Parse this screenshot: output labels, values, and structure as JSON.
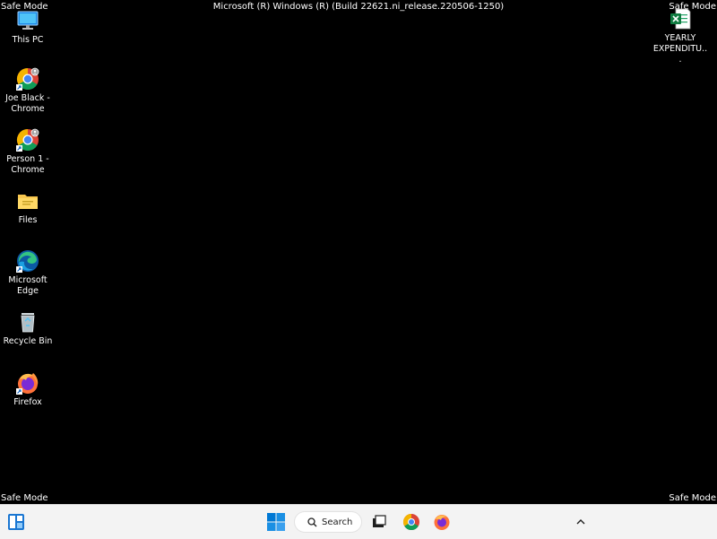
{
  "window": {
    "build_title": "Microsoft (R) Windows (R) (Build 22621.ni_release.220506-1250)",
    "safe_mode_top_left": "Safe Mode",
    "safe_mode_top_right": "Safe Mode",
    "safe_mode_bottom_left": "Safe Mode",
    "safe_mode_bottom_right": "Safe Mode"
  },
  "desktop": {
    "icons": [
      {
        "label": "This PC",
        "icon": "monitor-icon"
      },
      {
        "label": "Joe Black - Chrome",
        "icon": "chrome-profile-icon"
      },
      {
        "label": "Person 1 - Chrome",
        "icon": "chrome-profile-icon"
      },
      {
        "label": "Files",
        "icon": "folder-icon"
      },
      {
        "label": "Microsoft Edge",
        "icon": "edge-icon"
      },
      {
        "label": "Recycle Bin",
        "icon": "recycle-bin-icon"
      },
      {
        "label": "Firefox",
        "icon": "firefox-icon"
      },
      {
        "label": "YEARLY EXPENDITU...",
        "icon": "excel-file-icon"
      }
    ]
  },
  "taskbar": {
    "search_label": "Search",
    "items": [
      "widgets-icon",
      "start-icon",
      "search-icon",
      "task-view-icon",
      "chrome-icon",
      "firefox-icon",
      "chevron-up-icon"
    ]
  }
}
